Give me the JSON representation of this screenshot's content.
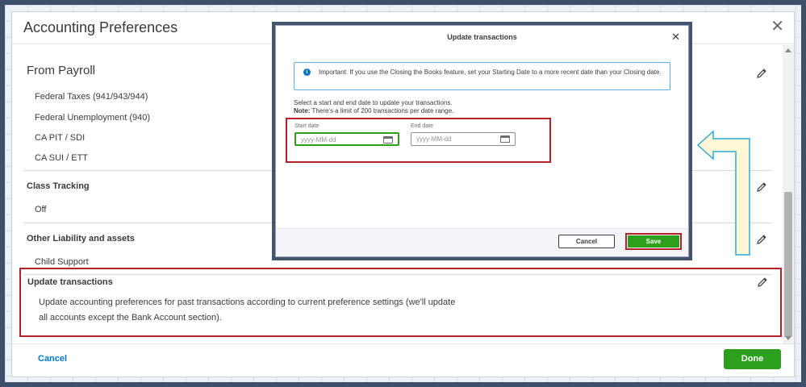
{
  "panel": {
    "title": "Accounting Preferences",
    "close_glyph": "✕",
    "payroll": {
      "title": "From Payroll",
      "items": [
        "Federal Taxes (941/943/944)",
        "Federal Unemployment (940)",
        "CA PIT / SDI",
        "CA SUI / ETT"
      ]
    },
    "class_tracking": {
      "title": "Class Tracking",
      "value": "Off"
    },
    "other_liability": {
      "title": "Other Liability and assets",
      "value": "Child Support"
    },
    "update_transactions": {
      "title": "Update transactions",
      "description": "Update accounting preferences for past transactions according to current preference settings (we'll update all accounts except the Bank Account section)."
    },
    "footer": {
      "cancel_label": "Cancel",
      "done_label": "Done"
    }
  },
  "modal": {
    "title": "Update transactions",
    "close_glyph": "✕",
    "info_icon": "i",
    "info_text": "Important: If you use the Closing the Books feature, set your Starting Date to a more recent date than your Closing date.",
    "instructions": "Select a start and end date to update your transactions.",
    "note_label": "Note:",
    "note_text": " There's a limit of 200 transactions per date range.",
    "start_date": {
      "label": "Start date",
      "placeholder": "yyyy-MM-dd"
    },
    "end_date": {
      "label": "End date",
      "placeholder": "yyyy-MM-dd"
    },
    "cancel_label": "Cancel",
    "save_label": "Save"
  },
  "colors": {
    "accent_green": "#2ca01c",
    "link_blue": "#0077c5",
    "highlight_red": "#b5202b",
    "arrow_fill": "#fff8d6",
    "arrow_stroke": "#2fa8d8"
  },
  "icons": {
    "edit": "pencil-icon",
    "calendar": "calendar-icon",
    "info": "info-icon",
    "close": "close-icon"
  }
}
